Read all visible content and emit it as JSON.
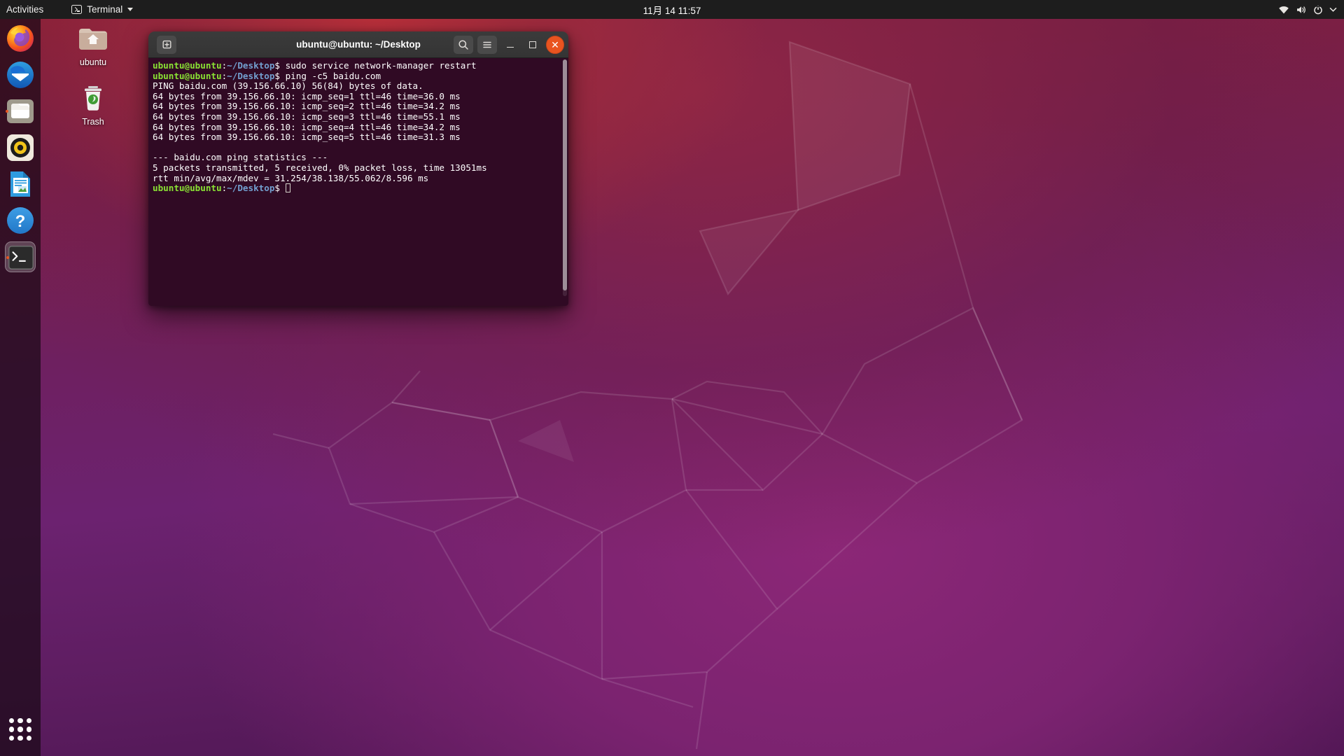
{
  "topbar": {
    "activities": "Activities",
    "app_menu": "Terminal",
    "app_menu_icon": "terminal-icon",
    "clock": "11月 14 11:57",
    "tray_icons": [
      "network-wifi-icon",
      "volume-icon",
      "power-icon",
      "chevron-down-icon"
    ]
  },
  "dock": {
    "items": [
      {
        "name": "firefox",
        "label": "Firefox Web Browser",
        "running": false
      },
      {
        "name": "thunderbird",
        "label": "Thunderbird Mail",
        "running": false
      },
      {
        "name": "files",
        "label": "Files",
        "running": true
      },
      {
        "name": "rhythmbox",
        "label": "Rhythmbox",
        "running": false
      },
      {
        "name": "libreoffice-writer",
        "label": "LibreOffice Writer",
        "running": false
      },
      {
        "name": "help",
        "label": "Help",
        "running": false
      },
      {
        "name": "terminal",
        "label": "Terminal",
        "running": true
      }
    ],
    "show_apps_label": "Show Applications"
  },
  "desktop_icons": [
    {
      "name": "home-folder",
      "label": "ubuntu",
      "icon": "home-folder-icon"
    },
    {
      "name": "trash",
      "label": "Trash",
      "icon": "trash-icon"
    }
  ],
  "window": {
    "title": "ubuntu@ubuntu: ~/Desktop",
    "new_tab_icon": "new-tab-icon",
    "search_icon": "search-icon",
    "menu_icon": "hamburger-menu-icon",
    "minimize_icon": "minimize-icon",
    "maximize_icon": "maximize-icon",
    "close_icon": "close-icon",
    "close_color": "#e95420",
    "background_color": "#300a24"
  },
  "terminal": {
    "prompt_user": "ubuntu@ubuntu",
    "prompt_sep": ":",
    "prompt_path": "~/Desktop",
    "prompt_tail": "$ ",
    "lines": [
      {
        "type": "prompt",
        "command": "sudo service network-manager restart"
      },
      {
        "type": "prompt",
        "command": "ping -c5 baidu.com"
      },
      {
        "type": "out",
        "text": "PING baidu.com (39.156.66.10) 56(84) bytes of data."
      },
      {
        "type": "out",
        "text": "64 bytes from 39.156.66.10: icmp_seq=1 ttl=46 time=36.0 ms"
      },
      {
        "type": "out",
        "text": "64 bytes from 39.156.66.10: icmp_seq=2 ttl=46 time=34.2 ms"
      },
      {
        "type": "out",
        "text": "64 bytes from 39.156.66.10: icmp_seq=3 ttl=46 time=55.1 ms"
      },
      {
        "type": "out",
        "text": "64 bytes from 39.156.66.10: icmp_seq=4 ttl=46 time=34.2 ms"
      },
      {
        "type": "out",
        "text": "64 bytes from 39.156.66.10: icmp_seq=5 ttl=46 time=31.3 ms"
      },
      {
        "type": "out",
        "text": ""
      },
      {
        "type": "out",
        "text": "--- baidu.com ping statistics ---"
      },
      {
        "type": "out",
        "text": "5 packets transmitted, 5 received, 0% packet loss, time 13051ms"
      },
      {
        "type": "out",
        "text": "rtt min/avg/max/mdev = 31.254/38.138/55.062/8.596 ms"
      },
      {
        "type": "prompt",
        "command": ""
      }
    ]
  }
}
